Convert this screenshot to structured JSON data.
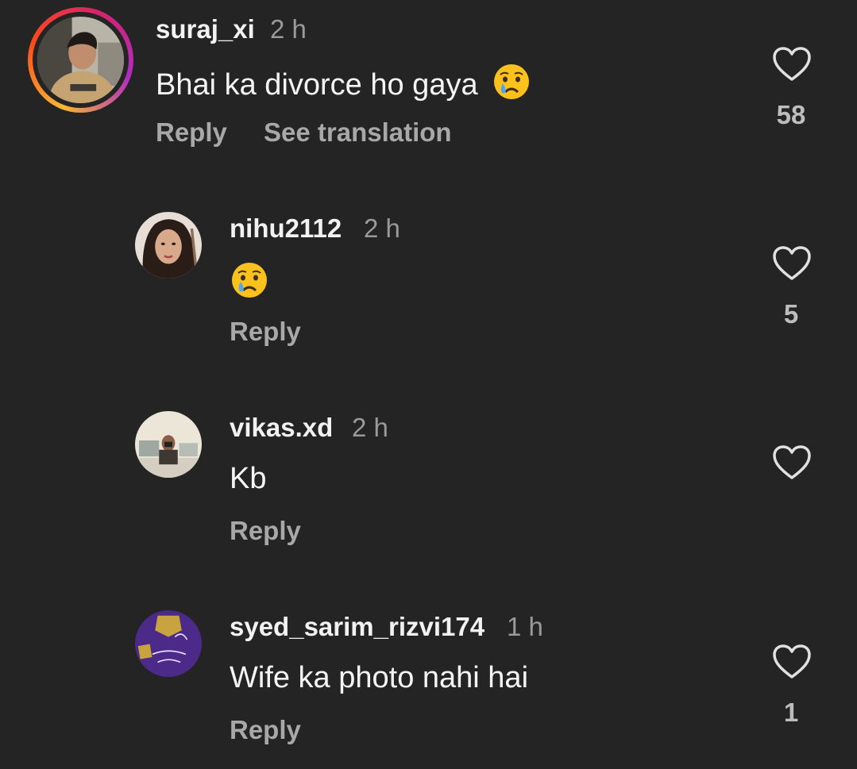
{
  "comments": [
    {
      "username": "suraj_xi",
      "time": "2 h",
      "text": "Bhai ka divorce ho gaya",
      "emoji": "crying-face-emoji",
      "reply_label": "Reply",
      "translate_label": "See translation",
      "likes": "58",
      "has_story_ring": true
    },
    {
      "username": "nihu2112",
      "time": "2 h",
      "text": "",
      "emoji": "crying-face-emoji",
      "reply_label": "Reply",
      "likes": "5"
    },
    {
      "username": "vikas.xd",
      "time": "2 h",
      "text": "Kb",
      "reply_label": "Reply",
      "likes": ""
    },
    {
      "username": "syed_sarim_rizvi174",
      "time": "1 h",
      "text": "Wife ka photo nahi hai",
      "reply_label": "Reply",
      "likes": "1"
    }
  ],
  "colors": {
    "background": "#242424",
    "username": "#f2f2f2",
    "muted": "#9a9a9a",
    "action": "#a8a8a8",
    "heart_outline": "#e0e0e0",
    "story_ring": [
      "#f7b733",
      "#fc4a1a",
      "#d5236c",
      "#b02bc1"
    ]
  },
  "icons": {
    "like": "heart-outline-icon",
    "emoji": "crying-face-emoji"
  }
}
